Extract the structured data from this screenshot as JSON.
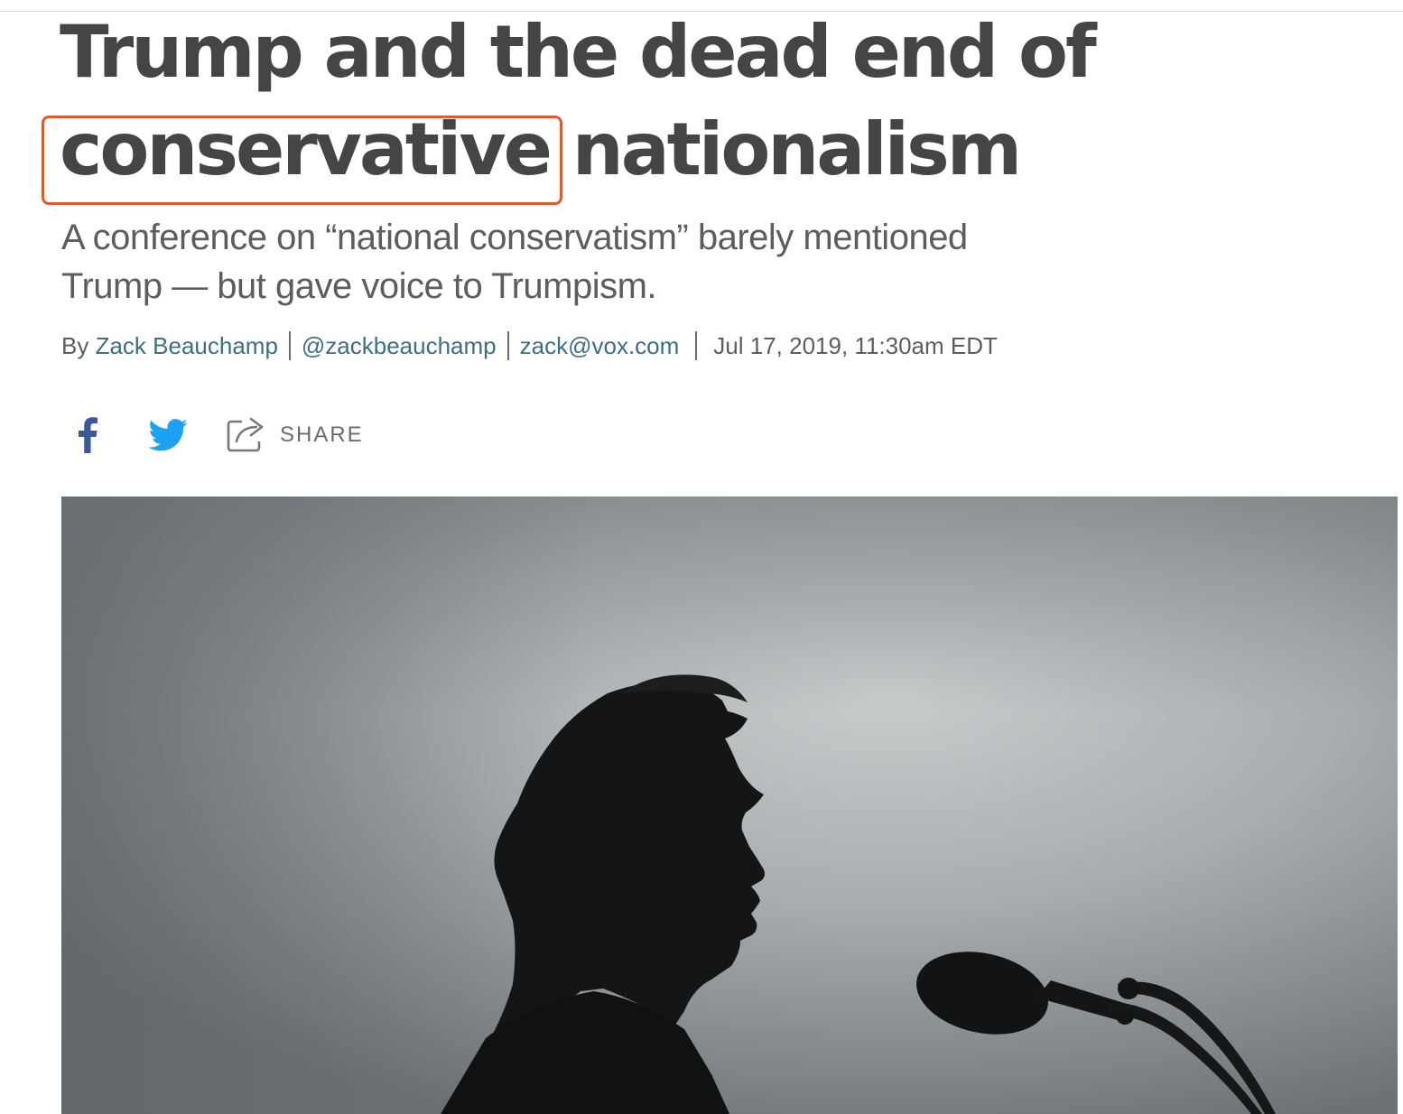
{
  "article": {
    "headline_part1": "Trump and the dead end of",
    "headline_highlight": "conservative",
    "headline_part2": "nationalism",
    "dek_line1": "A conference on “national conservatism” barely mentioned",
    "dek_line2": "Trump — but gave voice to Trumpism."
  },
  "byline": {
    "prefix": "By",
    "author": "Zack Beauchamp",
    "twitter": "@zackbeauchamp",
    "email": "zack@vox.com",
    "date": "Jul 17, 2019, 11:30am EDT"
  },
  "share": {
    "facebook_icon": "facebook-icon",
    "twitter_icon": "twitter-icon",
    "share_icon": "share-icon",
    "share_label": "SHARE"
  },
  "colors": {
    "headline": "#444546",
    "highlight_border": "#e05a2b",
    "facebook": "#3b5998",
    "twitter": "#1da1f2",
    "link": "#3b6f83"
  },
  "hero_image": {
    "subject": "silhouette of a man speaking into a microphone against an overcast sky"
  }
}
